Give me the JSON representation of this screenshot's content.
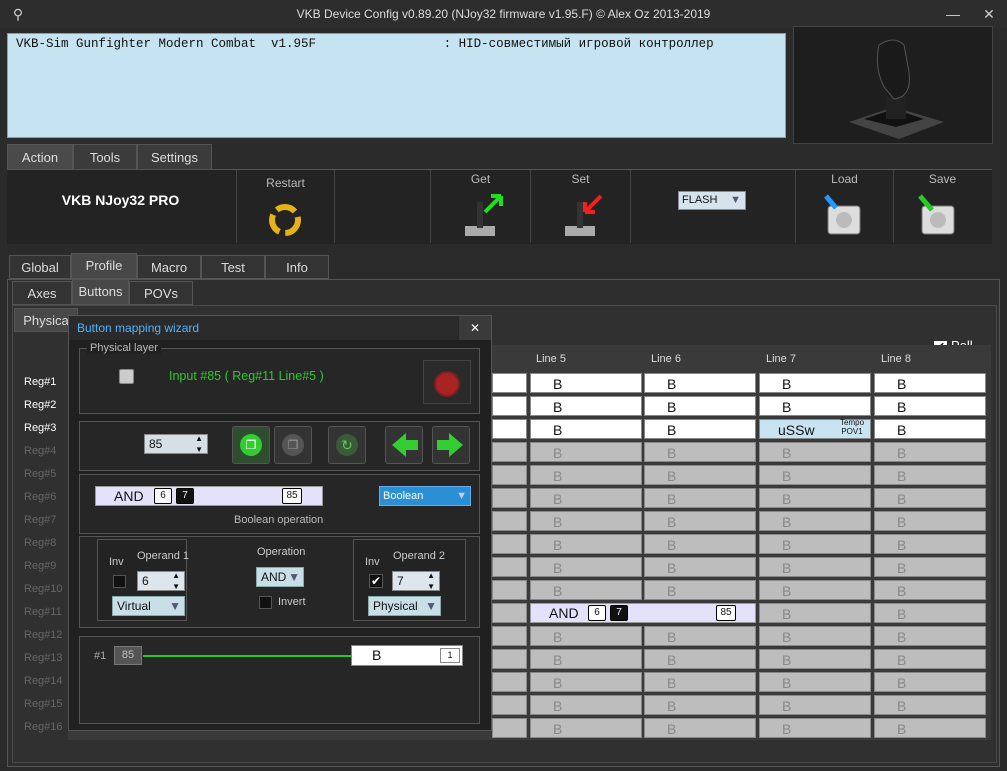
{
  "window": {
    "title": "VKB Device Config v0.89.20 (NJoy32 firmware v1.95.F) © Alex Oz 2013-2019"
  },
  "console": {
    "line1": "VKB-Sim Gunfighter Modern Combat  v1.95F                 : HID-совместимый игровой контроллер"
  },
  "main_tabs": [
    "Action",
    "Tools",
    "Settings"
  ],
  "toolbar": {
    "device": "VKB NJoy32 PRO",
    "restart": "Restart",
    "get": "Get",
    "set": "Set",
    "flash": "FLASH",
    "load": "Load",
    "save": "Save"
  },
  "tabs": [
    "Global",
    "Profile",
    "Macro",
    "Test",
    "Info"
  ],
  "subtabs": [
    "Axes",
    "Buttons",
    "POVs"
  ],
  "physical_tab": "Physica",
  "poll": "Poll",
  "columns": [
    "Line 5",
    "Line 6",
    "Line 7",
    "Line 8"
  ],
  "rows": [
    "Reg#1",
    "Reg#2",
    "Reg#3",
    "Reg#4",
    "Reg#5",
    "Reg#6",
    "Reg#7",
    "Reg#8",
    "Reg#9",
    "Reg#10",
    "Reg#11",
    "Reg#12",
    "Reg#13",
    "Reg#14",
    "Reg#15",
    "Reg#16"
  ],
  "cell": "B",
  "special": {
    "ussw": "uSSw",
    "tempo": "Tempo",
    "pov": "POV1",
    "and": "AND",
    "op1": "6",
    "op2": "7",
    "num": "85"
  },
  "wizard": {
    "title": "Button mapping wizard",
    "close": "✕",
    "physical_layer": "Physical layer",
    "input_info": "Input #85 ( Reg#11  Line#5 )",
    "spin_value": "85",
    "and_label": "AND",
    "op1": "6",
    "op2": "7",
    "num": "85",
    "type": "Boolean",
    "bool_caption": "Boolean operation",
    "inv": "Inv",
    "operand1": "Operand 1",
    "operand2": "Operand 2",
    "operation": "Operation",
    "op1_value": "6",
    "op2_value": "7",
    "op1_type": "Virtual",
    "op2_type": "Physical",
    "operation_value": "AND",
    "invert": "Invert",
    "line_index": "#1",
    "line_input": "85",
    "out_label": "B",
    "out_num": "1"
  }
}
